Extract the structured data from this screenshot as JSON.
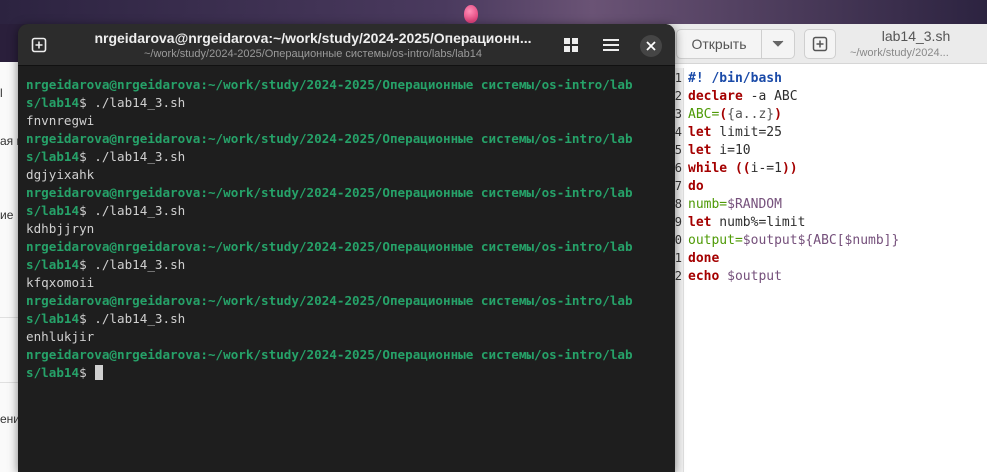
{
  "left_window": {
    "fragments": [
      "l",
      "ая п",
      "ие",
      "ени"
    ]
  },
  "terminal": {
    "title": "nrgeidarova@nrgeidarova:~/work/study/2024-2025/Операционн...",
    "subtitle": "~/work/study/2024-2025/Операционные системы/os-intro/labs/lab14",
    "icons": {
      "new_tab": "new-tab-icon",
      "view": "grid-icon",
      "menu": "hamburger-icon",
      "close": "close-icon"
    },
    "prompt_user": "nrgeidarova@nrgeidarova",
    "prompt_path_line1": ":~/work/study/2024-2025/Операционные системы/os-intro/lab",
    "prompt_path_line2": "s/lab14",
    "prompt_symbol": "$ ",
    "runs": [
      {
        "command": "./lab14_3.sh",
        "output": "fnvnregwi"
      },
      {
        "command": "./lab14_3.sh",
        "output": "dgjyixahk"
      },
      {
        "command": "./lab14_3.sh",
        "output": "kdhbjjryn"
      },
      {
        "command": "./lab14_3.sh",
        "output": "kfqxomoii"
      },
      {
        "command": "./lab14_3.sh",
        "output": "enhlukjir"
      }
    ],
    "colors": {
      "prompt": "#26a269",
      "background": "#1e1e1e"
    }
  },
  "editor": {
    "open_label": "Открыть",
    "title": "lab14_3.sh",
    "subtitle": "~/work/study/2024...",
    "line_numbers": [
      "1",
      "2",
      "3",
      "4",
      "5",
      "6",
      "7",
      "8",
      "9",
      "0",
      "1",
      "2"
    ],
    "code": [
      [
        {
          "t": "#! /bin/bash",
          "c": "c-comment"
        }
      ],
      [
        {
          "t": "declare",
          "c": "c-kw"
        },
        {
          "t": " -a ABC",
          "c": ""
        }
      ],
      [
        {
          "t": "ABC=",
          "c": "c-var"
        },
        {
          "t": "(",
          "c": "c-paren"
        },
        {
          "t": "{a..z}",
          "c": "c-exp"
        },
        {
          "t": ")",
          "c": "c-paren"
        }
      ],
      [
        {
          "t": "let",
          "c": "c-kw"
        },
        {
          "t": " limit=25",
          "c": ""
        }
      ],
      [
        {
          "t": "let",
          "c": "c-kw"
        },
        {
          "t": " i=10",
          "c": ""
        }
      ],
      [
        {
          "t": "while",
          "c": "c-kw"
        },
        {
          "t": " ((",
          "c": "c-paren"
        },
        {
          "t": "i-=1",
          "c": ""
        },
        {
          "t": "))",
          "c": "c-paren"
        }
      ],
      [
        {
          "t": "do",
          "c": "c-kw"
        }
      ],
      [
        {
          "t": "numb=",
          "c": "c-var"
        },
        {
          "t": "$RANDOM",
          "c": "c-sub"
        }
      ],
      [
        {
          "t": "let",
          "c": "c-kw"
        },
        {
          "t": " numb%=limit",
          "c": ""
        }
      ],
      [
        {
          "t": "output=",
          "c": "c-var"
        },
        {
          "t": "$output${ABC[$numb]}",
          "c": "c-sub"
        }
      ],
      [
        {
          "t": "done",
          "c": "c-kw"
        }
      ],
      [
        {
          "t": "echo",
          "c": "c-kw"
        },
        {
          "t": " ",
          "c": ""
        },
        {
          "t": "$output",
          "c": "c-sub"
        }
      ]
    ]
  }
}
